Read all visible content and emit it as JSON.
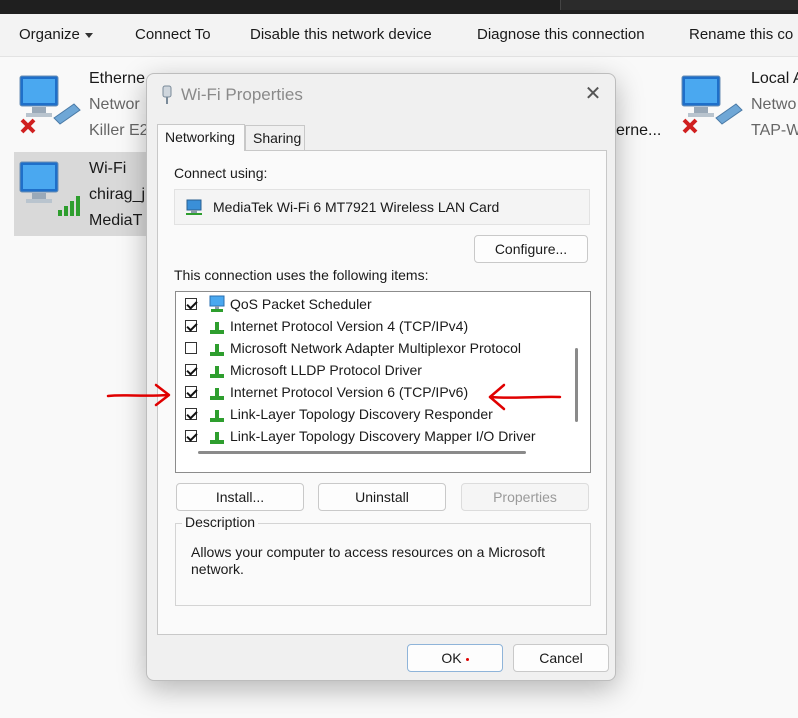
{
  "toolbar": {
    "organize": "Organize",
    "connect_to": "Connect To",
    "disable": "Disable this network device",
    "diagnose": "Diagnose this connection",
    "rename": "Rename this co"
  },
  "adapters": {
    "ethernet": {
      "name": "Etherne",
      "line2": "Networ",
      "line3": "Killer E2"
    },
    "ethernet_partial": {
      "line3": "erne..."
    },
    "local": {
      "name": "Local A",
      "line2": "Netwo",
      "line3": "TAP-W"
    },
    "wifi": {
      "name": "Wi-Fi",
      "line2": "chirag_j",
      "line3": "MediaT"
    }
  },
  "dialog": {
    "title": "Wi-Fi Properties",
    "tabs": [
      "Networking",
      "Sharing"
    ],
    "connect_using_label": "Connect using:",
    "adapter_name": "MediaTek Wi-Fi 6 MT7921 Wireless LAN Card",
    "configure_label": "Configure...",
    "items_label": "This connection uses the following items:",
    "items": [
      {
        "label": "QoS Packet Scheduler",
        "checked": true,
        "icon": "monitor-network-icon"
      },
      {
        "label": "Internet Protocol Version 4 (TCP/IPv4)",
        "checked": true,
        "icon": "protocol-icon"
      },
      {
        "label": "Microsoft Network Adapter Multiplexor Protocol",
        "checked": false,
        "icon": "protocol-icon"
      },
      {
        "label": "Microsoft LLDP Protocol Driver",
        "checked": true,
        "icon": "protocol-icon"
      },
      {
        "label": "Internet Protocol Version 6 (TCP/IPv6)",
        "checked": true,
        "icon": "protocol-icon"
      },
      {
        "label": "Link-Layer Topology Discovery Responder",
        "checked": true,
        "icon": "protocol-icon"
      },
      {
        "label": "Link-Layer Topology Discovery Mapper I/O Driver",
        "checked": true,
        "icon": "protocol-icon"
      }
    ],
    "install_label": "Install...",
    "uninstall_label": "Uninstall",
    "properties_label": "Properties",
    "description_legend": "Description",
    "description_text": "Allows your computer to access resources on a Microsoft network.",
    "ok_label": "OK",
    "cancel_label": "Cancel"
  },
  "colors": {
    "annotation": "#e00000",
    "accent_green": "#2e9e2e"
  }
}
